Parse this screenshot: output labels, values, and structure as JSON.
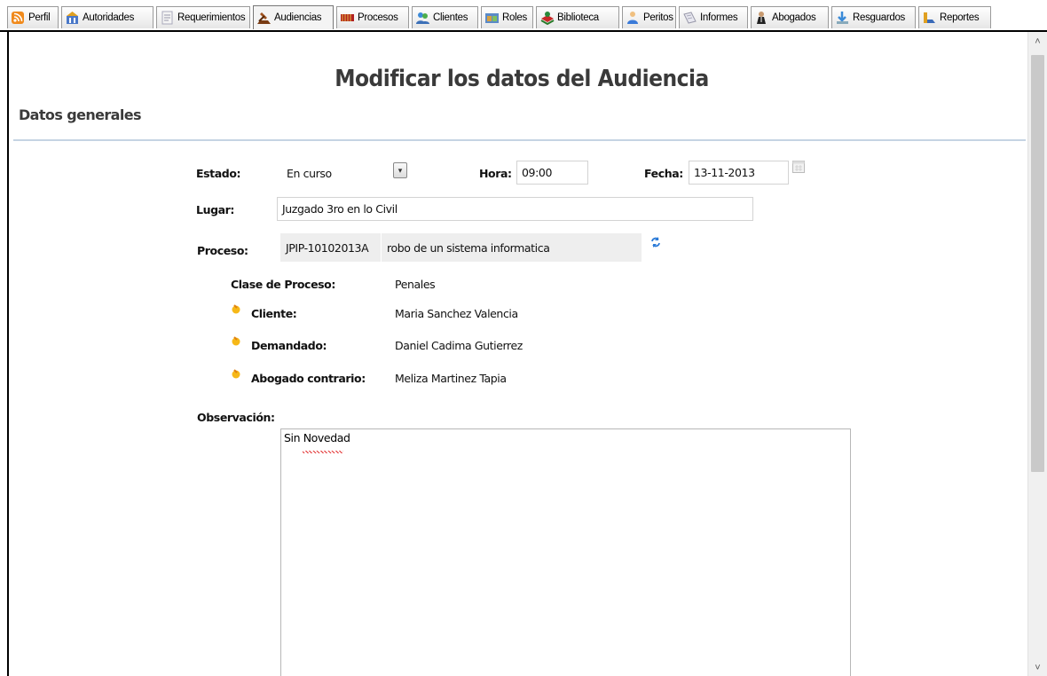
{
  "tabs": [
    {
      "label": "Perfil",
      "icon": "rss-icon"
    },
    {
      "label": "Autoridades",
      "icon": "authority-icon"
    },
    {
      "label": "Requerimientos",
      "icon": "document-icon"
    },
    {
      "label": "Audiencias",
      "icon": "hammer-icon"
    },
    {
      "label": "Procesos",
      "icon": "process-icon"
    },
    {
      "label": "Clientes",
      "icon": "clients-icon"
    },
    {
      "label": "Roles",
      "icon": "roles-icon"
    },
    {
      "label": "Biblioteca",
      "icon": "library-icon"
    },
    {
      "label": "Peritos",
      "icon": "expert-icon"
    },
    {
      "label": "Informes",
      "icon": "report-icon"
    },
    {
      "label": "Abogados",
      "icon": "lawyer-icon"
    },
    {
      "label": "Resguardos",
      "icon": "download-icon"
    },
    {
      "label": "Reportes",
      "icon": "chart-icon"
    }
  ],
  "active_tab": "Audiencias",
  "page": {
    "title": "Modificar los datos del Audiencia",
    "section": "Datos generales"
  },
  "form": {
    "estado_label": "Estado:",
    "estado_value": "En curso",
    "hora_label": "Hora:",
    "hora_value": "09:00",
    "fecha_label": "Fecha:",
    "fecha_value": "13-11-2013",
    "lugar_label": "Lugar:",
    "lugar_value": "Juzgado 3ro en lo Civil",
    "proceso_label": "Proceso:",
    "proceso_code": "JPIP-10102013A",
    "proceso_desc": "robo de un sistema informatica",
    "clase_label": "Clase de Proceso:",
    "clase_value": "Penales",
    "cliente_label": "Cliente:",
    "cliente_value": "Maria Sanchez Valencia",
    "demandado_label": "Demandado:",
    "demandado_value": "Daniel Cadima Gutierrez",
    "abogado_label": "Abogado contrario:",
    "abogado_value": "Meliza Martinez Tapia",
    "observacion_label": "Observación:",
    "observacion_value": "Sin Novedad"
  },
  "colors": {
    "title": "#3a3a3a",
    "divider": "#c5d4e3",
    "readonly_bg": "#eeeeee"
  }
}
